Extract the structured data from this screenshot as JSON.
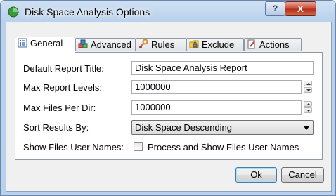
{
  "window": {
    "title": "Disk Space Analysis Options",
    "help_label": "?",
    "close_label": "X"
  },
  "tabs": [
    {
      "label": "General",
      "icon": "list-icon",
      "active": true
    },
    {
      "label": "Advanced",
      "icon": "cubes-icon",
      "active": false
    },
    {
      "label": "Rules",
      "icon": "wrench-icon",
      "active": false
    },
    {
      "label": "Exclude",
      "icon": "folder-lock-icon",
      "active": false
    },
    {
      "label": "Actions",
      "icon": "document-pen-icon",
      "active": false
    }
  ],
  "general": {
    "report_title_label": "Default Report Title:",
    "report_title_value": "Disk Space Analysis Report",
    "report_levels_label": "Max Report Levels:",
    "report_levels_value": "1000000",
    "files_per_dir_label": "Max Files Per Dir:",
    "files_per_dir_value": "1000000",
    "sort_label": "Sort Results By:",
    "sort_value": "Disk Space Descending",
    "show_names_label": "Show Files User Names:",
    "show_names_checkbox_label": "Process and Show Files User Names",
    "show_names_checked": false
  },
  "buttons": {
    "ok_label": "Ok",
    "cancel_label": "Cancel"
  },
  "colors": {
    "title_bar": "#b9d1ec",
    "close_button": "#c9452f",
    "panel_background": "#ffffff",
    "dialog_background": "#f0f0f0"
  }
}
